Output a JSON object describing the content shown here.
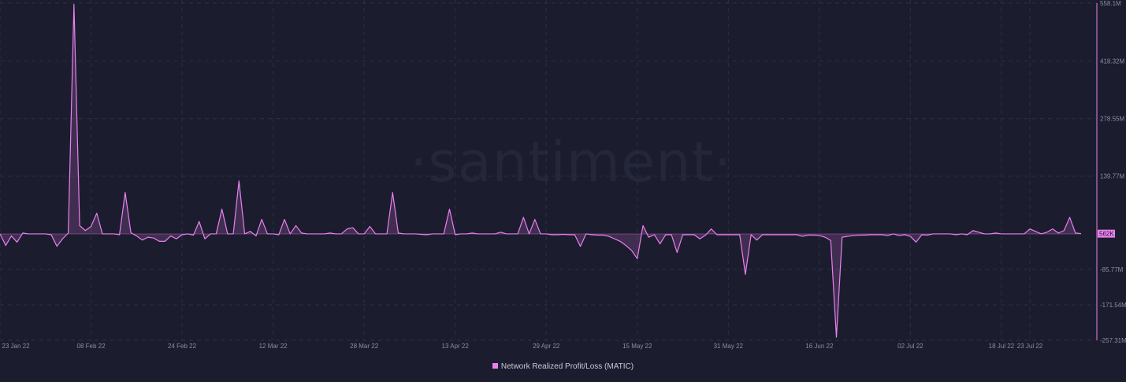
{
  "colors": {
    "background": "#1b1d2e",
    "series": "#ea80f0",
    "grid": "#2c2f44",
    "text": "#8a8ea6",
    "watermark": "#24263a"
  },
  "watermark": "·santiment·",
  "chart_data": {
    "type": "area",
    "y_axis_side": "right",
    "grid": true,
    "legend_position": "bottom-center",
    "ylim": [
      -257.31,
      558.1
    ],
    "y_ticks": [
      {
        "value": 558.1,
        "label": "558.1M"
      },
      {
        "value": 418.32,
        "label": "418.32M"
      },
      {
        "value": 278.55,
        "label": "278.55M"
      },
      {
        "value": 139.77,
        "label": "139.77M"
      },
      {
        "value": -85.77,
        "label": "-85.77M"
      },
      {
        "value": -171.54,
        "label": "-171.54M"
      },
      {
        "value": -257.31,
        "label": "-257.31M"
      }
    ],
    "x_ticks": [
      {
        "day": 1,
        "label": "23 Jan 22"
      },
      {
        "day": 17,
        "label": "08 Feb 22"
      },
      {
        "day": 33,
        "label": "24 Feb 22"
      },
      {
        "day": 49,
        "label": "12 Mar 22"
      },
      {
        "day": 65,
        "label": "28 Mar 22"
      },
      {
        "day": 81,
        "label": "13 Apr 22"
      },
      {
        "day": 97,
        "label": "29 Apr 22"
      },
      {
        "day": 113,
        "label": "15 May 22"
      },
      {
        "day": 129,
        "label": "31 May 22"
      },
      {
        "day": 145,
        "label": "16 Jun 22"
      },
      {
        "day": 161,
        "label": "02 Jul 22"
      },
      {
        "day": 177,
        "label": "18 Jul 22"
      },
      {
        "day": 182,
        "label": "23 Jul 22"
      }
    ],
    "last_value_label": "562K",
    "series": [
      {
        "name": "Network Realized Profit/Loss (MATIC)",
        "color": "#ea80f0",
        "x_start": "23 Jan 22",
        "x_step_days": 1,
        "values": [
          0,
          -28,
          -5,
          -20,
          2,
          0,
          0,
          0,
          0,
          -2,
          -30,
          -12,
          2,
          555,
          20,
          8,
          18,
          50,
          0,
          0,
          0,
          -2,
          100,
          3,
          -5,
          -15,
          -8,
          -10,
          -18,
          -18,
          -5,
          -12,
          -2,
          0,
          -3,
          30,
          -12,
          0,
          0,
          60,
          0,
          0,
          128,
          0,
          6,
          -5,
          35,
          0,
          0,
          -2,
          35,
          0,
          20,
          2,
          0,
          0,
          0,
          0,
          2,
          0,
          0,
          12,
          15,
          0,
          0,
          18,
          0,
          0,
          0,
          100,
          2,
          0,
          0,
          0,
          -1,
          -2,
          0,
          0,
          0,
          60,
          -2,
          0,
          0,
          2,
          0,
          0,
          0,
          0,
          4,
          0,
          0,
          0,
          40,
          0,
          35,
          0,
          0,
          -2,
          -2,
          -1,
          -2,
          -2,
          -30,
          0,
          -2,
          -3,
          -3,
          -6,
          -12,
          -18,
          -28,
          -40,
          -60,
          20,
          -8,
          -2,
          -24,
          -2,
          -2,
          -45,
          -2,
          -2,
          -2,
          -12,
          -3,
          12,
          -2,
          -2,
          -2,
          -2,
          -2,
          -98,
          -2,
          -15,
          -2,
          -2,
          -2,
          -2,
          -2,
          -2,
          -2,
          -6,
          -3,
          -3,
          -4,
          -8,
          -16,
          -250,
          -8,
          -6,
          -4,
          -3,
          -3,
          -2,
          -2,
          -2,
          -4,
          0,
          -4,
          -2,
          -6,
          -20,
          -2,
          -3,
          0,
          0,
          0,
          0,
          -2,
          0,
          -2,
          8,
          4,
          0,
          0,
          2,
          0,
          0,
          0,
          0,
          0,
          12,
          6,
          0,
          4,
          12,
          2,
          8,
          40,
          2,
          0.562
        ]
      }
    ]
  }
}
